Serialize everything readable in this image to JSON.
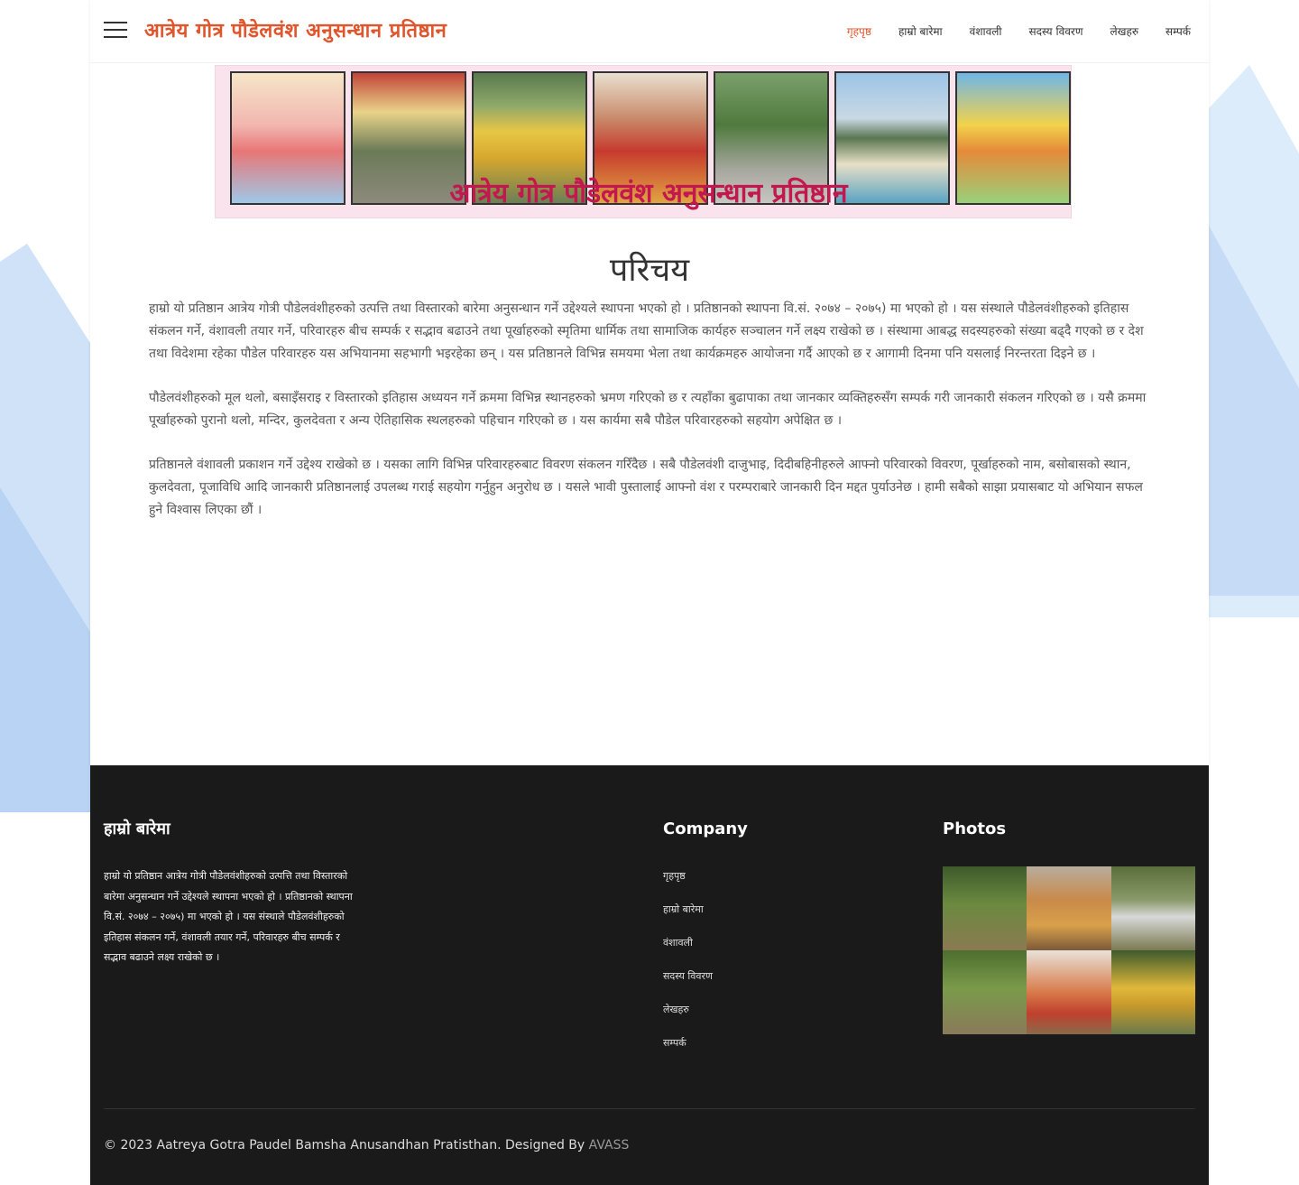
{
  "header": {
    "site_title": "आत्रेय गोत्र पौडेलवंश अनुसन्धान प्रतिष्ठान",
    "nav": [
      {
        "label": "गृहपृष्ठ",
        "active": true
      },
      {
        "label": "हाम्रो बारेमा",
        "active": false
      },
      {
        "label": "वंशावली",
        "active": false
      },
      {
        "label": "सदस्य विवरण",
        "active": false
      },
      {
        "label": "लेखहरु",
        "active": false
      },
      {
        "label": "सम्पर्क",
        "active": false
      }
    ]
  },
  "banner": {
    "caption": "आत्रेय गोत्र पौडेलवंश अनुसन्धान प्रतिष्ठान"
  },
  "main": {
    "title": "परिचय",
    "paragraphs": [
      "हाम्रो यो प्रतिष्ठान आत्रेय गोत्री पौडेलवंशीहरुको उत्पत्ति तथा विस्तारको बारेमा अनुसन्धान गर्ने उद्देश्यले स्थापना भएको हो । प्रतिष्ठानको स्थापना वि.सं. २०७४ – २०७५) मा भएको हो । यस संस्थाले पौडेलवंशीहरुको इतिहास संकलन गर्ने, वंशावली तयार गर्ने, परिवारहरु बीच सम्पर्क र सद्भाव बढाउने तथा पूर्खाहरुको स्मृतिमा धार्मिक तथा सामाजिक कार्यहरु सञ्चालन गर्ने लक्ष्य राखेको छ । संस्थामा आबद्ध सदस्यहरुको संख्या बढ्दै गएको छ र देश तथा विदेशमा रहेका पौडेल परिवारहरु यस अभियानमा सहभागी भइरहेका छन् । यस प्रतिष्ठानले विभिन्न समयमा भेला तथा कार्यक्रमहरु आयोजना गर्दै आएको छ र आगामी दिनमा पनि यसलाई निरन्तरता दिइने छ ।",
      "पौडेलवंशीहरुको मूल थलो, बसाइँसराइ र विस्तारको इतिहास अध्ययन गर्ने क्रममा विभिन्न स्थानहरुको भ्रमण गरिएको छ र त्यहाँका बुढापाका तथा जानकार व्यक्तिहरुसँग सम्पर्क गरी जानकारी संकलन गरिएको छ । यसै क्रममा पूर्खाहरुको पुरानो थलो, मन्दिर, कुलदेवता र अन्य ऐतिहासिक स्थलहरुको पहिचान गरिएको छ । यस कार्यमा सबै पौडेल परिवारहरुको सहयोग अपेक्षित छ ।",
      "प्रतिष्ठानले वंशावली प्रकाशन गर्ने उद्देश्य राखेको छ । यसका लागि विभिन्न परिवारहरुबाट विवरण संकलन गरिँदैछ । सबै पौडेलवंशी दाजुभाइ, दिदीबहिनीहरुले आफ्नो परिवारको विवरण, पूर्खाहरुको नाम, बसोबासको स्थान, कुलदेवता, पूजाविधि आदि जानकारी प्रतिष्ठानलाई उपलब्ध गराई सहयोग गर्नुहुन अनुरोध छ । यसले भावी पुस्तालाई आफ्नो वंश र परम्पराबारे जानकारी दिन मद्दत पुर्याउनेछ । हामी सबैको साझा प्रयासबाट यो अभियान सफल हुने विश्वास लिएका छौं ।"
    ]
  },
  "footer": {
    "about": {
      "heading": "हाम्रो बारेमा",
      "text": "हाम्रो यो प्रतिष्ठान आत्रेय गोत्री पौडेलवंशीहरुको उत्पत्ति तथा विस्तारको बारेमा अनुसन्धान गर्ने उद्देश्यले स्थापना भएको हो । प्रतिष्ठानको स्थापना वि.सं. २०७४ – २०७५) मा भएको हो । यस संस्थाले पौडेलवंशीहरुको इतिहास संकलन गर्ने, वंशावली तयार गर्ने, परिवारहरु बीच सम्पर्क र सद्भाव बढाउने लक्ष्य राखेको छ ।"
    },
    "company": {
      "heading": "Company",
      "links": [
        "गृहपृष्ठ",
        "हाम्रो बारेमा",
        "वंशावली",
        "सदस्य विवरण",
        "लेखहरु",
        "सम्पर्क"
      ]
    },
    "photos": {
      "heading": "Photos"
    },
    "copyright": "© 2023 Aatreya Gotra Paudel Bamsha Anusandhan Pratisthan. Designed By",
    "designer": "AVASS"
  },
  "colors": {
    "accent": "#e0552c",
    "footer_bg": "#1a1a1a",
    "banner_bg": "#fbe3ee",
    "banner_text": "#c2184f"
  }
}
